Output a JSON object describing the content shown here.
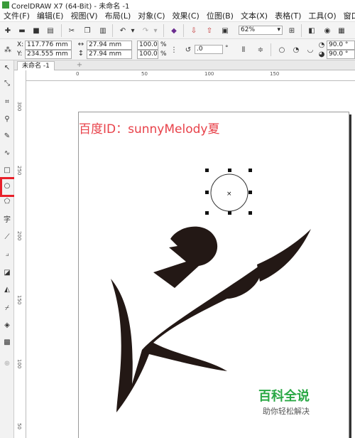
{
  "window": {
    "title": "CorelDRAW X7 (64-Bit) - 未命名 -1"
  },
  "menu": [
    "文件(F)",
    "编辑(E)",
    "视图(V)",
    "布局(L)",
    "对象(C)",
    "效果(C)",
    "位图(B)",
    "文本(X)",
    "表格(T)",
    "工具(O)",
    "窗口(W)"
  ],
  "toolbar": {
    "zoom": "62%"
  },
  "property_bar": {
    "x": "117.776 mm",
    "y": "234.555 mm",
    "width": "27.94 mm",
    "height": "27.94 mm",
    "scale_w": "100.0",
    "scale_h": "100.0",
    "percent": "%",
    "rotation": ".0",
    "degree": "°",
    "angle1": "90.0 °",
    "angle2": "90.0 °",
    "x_label": "X:",
    "y_label": "Y:"
  },
  "tab": {
    "label": "未命名 -1",
    "add": "+"
  },
  "ruler": {
    "h_ticks": [
      "0",
      "50",
      "100",
      "150"
    ],
    "v_ticks": [
      "300",
      "250",
      "200",
      "150",
      "100",
      "50"
    ]
  },
  "canvas": {
    "watermark": "百度ID：sunnyMelody夏",
    "brand_title": "百科全说",
    "brand_sub": "助你轻松解决"
  },
  "colors": {
    "highlight": "#e8202a",
    "watermark": "#e8424a",
    "brand": "#2aa845",
    "artwork": "#231815"
  }
}
